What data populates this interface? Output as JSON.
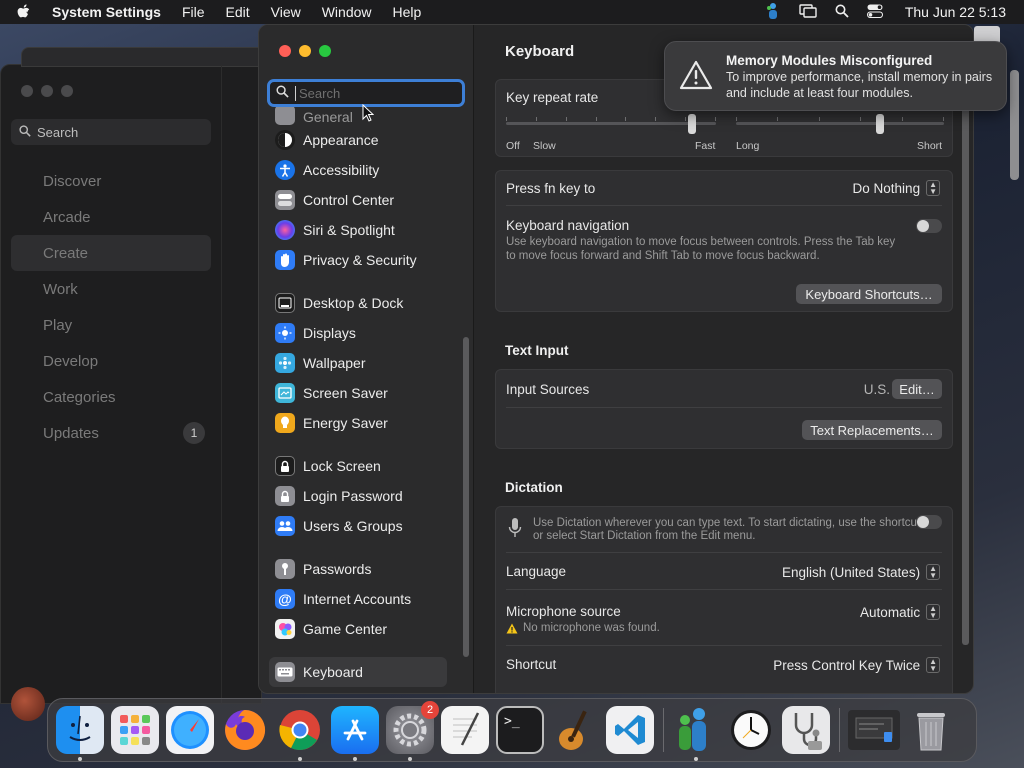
{
  "menubar": {
    "app_name": "System Settings",
    "items": [
      "File",
      "Edit",
      "View",
      "Window",
      "Help"
    ],
    "clock": "Thu Jun 22  5:13"
  },
  "bg_app": {
    "search_label": "Search",
    "nav": [
      {
        "label": "Discover"
      },
      {
        "label": "Arcade"
      },
      {
        "label": "Create"
      },
      {
        "label": "Work"
      },
      {
        "label": "Play"
      },
      {
        "label": "Develop"
      },
      {
        "label": "Categories"
      },
      {
        "label": "Updates",
        "badge": "1"
      }
    ]
  },
  "settings": {
    "search_placeholder": "Search",
    "sidebar": {
      "partial_top": "General",
      "group1": [
        {
          "label": "Appearance",
          "icon": "appearance-icon",
          "color": "#1c1c1c"
        },
        {
          "label": "Accessibility",
          "icon": "accessibility-icon",
          "color": "#1a73e8"
        },
        {
          "label": "Control Center",
          "icon": "control-center-icon",
          "color": "#8e8e93"
        },
        {
          "label": "Siri & Spotlight",
          "icon": "siri-icon",
          "color": "#c44cd9"
        },
        {
          "label": "Privacy & Security",
          "icon": "hand-icon",
          "color": "#2f7cf6"
        }
      ],
      "group2": [
        {
          "label": "Desktop & Dock",
          "icon": "dock-icon",
          "color": "#1c1c1c"
        },
        {
          "label": "Displays",
          "icon": "displays-icon",
          "color": "#2f7cf6"
        },
        {
          "label": "Wallpaper",
          "icon": "wallpaper-icon",
          "color": "#35a8e0"
        },
        {
          "label": "Screen Saver",
          "icon": "screen-saver-icon",
          "color": "#3fb6d9"
        },
        {
          "label": "Energy Saver",
          "icon": "energy-icon",
          "color": "#f0a81c"
        }
      ],
      "group3": [
        {
          "label": "Lock Screen",
          "icon": "lock-icon",
          "color": "#1c1c1c"
        },
        {
          "label": "Login Password",
          "icon": "password-lock-icon",
          "color": "#8e8e93"
        },
        {
          "label": "Users & Groups",
          "icon": "users-icon",
          "color": "#2f7cf6"
        }
      ],
      "group4": [
        {
          "label": "Passwords",
          "icon": "key-icon",
          "color": "#8e8e93"
        },
        {
          "label": "Internet Accounts",
          "icon": "at-icon",
          "color": "#2f7cf6"
        },
        {
          "label": "Game Center",
          "icon": "game-center-icon",
          "color": "#e8e8e8"
        }
      ],
      "group5": [
        {
          "label": "Keyboard",
          "icon": "keyboard-icon",
          "color": "#8e8e93",
          "selected": true
        }
      ]
    },
    "main": {
      "title": "Keyboard",
      "key_repeat": {
        "label": "Key repeat rate",
        "left_labels": [
          "Off",
          "Slow",
          "Fast"
        ],
        "right_labels": [
          "Long",
          "Short"
        ],
        "repeat_level": 0.9,
        "delay_level": 0.7
      },
      "fn_key": {
        "label": "Press fn key to",
        "value": "Do Nothing"
      },
      "keyboard_nav": {
        "label": "Keyboard navigation",
        "desc1": "Use keyboard navigation to move focus between controls. Press the Tab key",
        "desc2": "to move focus forward and Shift Tab to move focus backward."
      },
      "shortcuts_button": "Keyboard Shortcuts…",
      "text_input": {
        "section": "Text Input",
        "label": "Input Sources",
        "value": "U.S.",
        "edit_button": "Edit…",
        "replacements_button": "Text Replacements…"
      },
      "dictation": {
        "section": "Dictation",
        "desc1": "Use Dictation wherever you can type text. To start dictating, use the shortcut",
        "desc2": "or select Start Dictation from the Edit menu.",
        "language_label": "Language",
        "language_value": "English (United States)",
        "mic_label": "Microphone source",
        "mic_value": "Automatic",
        "mic_warning": "No microphone was found.",
        "shortcut_label": "Shortcut",
        "shortcut_value": "Press Control Key Twice"
      }
    }
  },
  "notification": {
    "title": "Memory Modules Misconfigured",
    "body": "To improve performance, install memory in pairs and include at least four modules."
  },
  "dock": {
    "badge_settings": "2"
  },
  "colors": {
    "accent": "#3d7fd6",
    "warning": "#f5c518"
  }
}
